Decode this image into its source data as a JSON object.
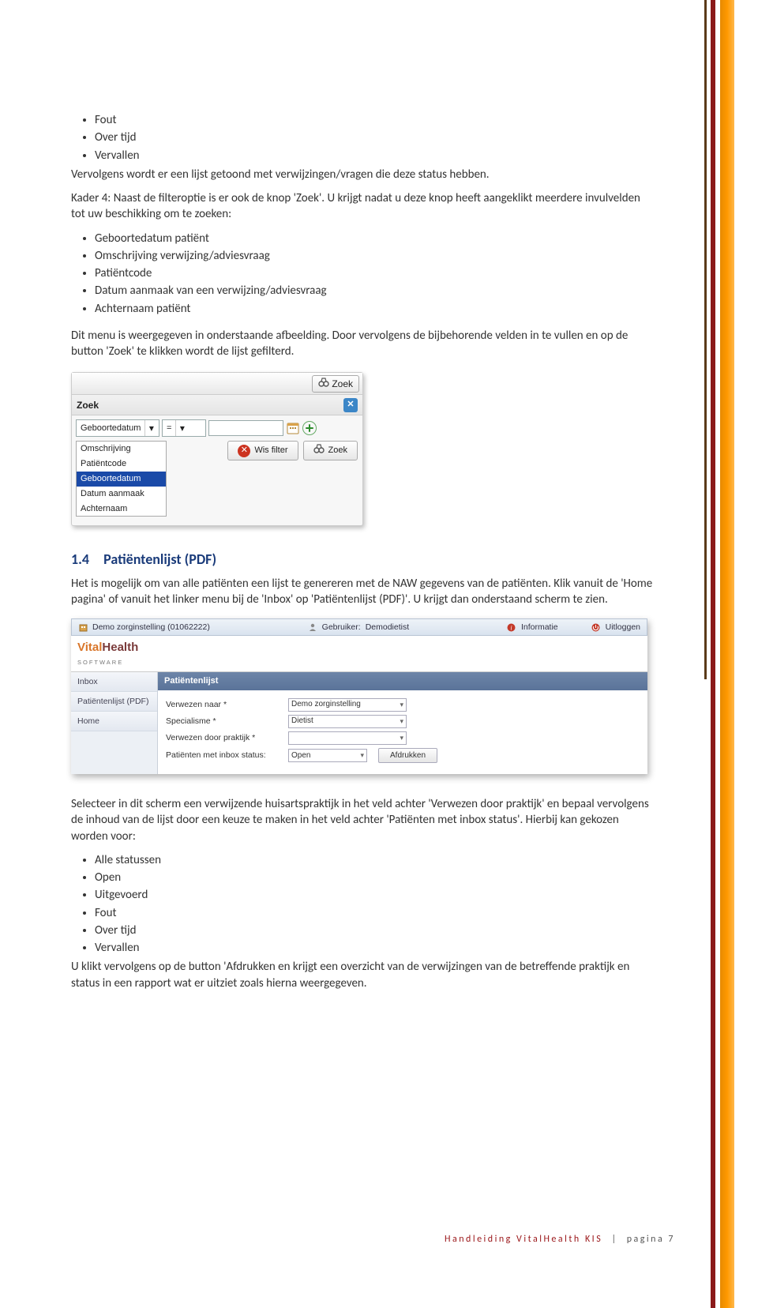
{
  "bullets_top": [
    "Fout",
    "Over tijd",
    "Vervallen"
  ],
  "para1": "Vervolgens wordt er een lijst getoond met verwijzingen/vragen die deze status hebben.",
  "para2": "Kader 4: Naast de filteroptie is er ook de knop 'Zoek'. U krijgt nadat u deze knop heeft aangeklikt meerdere invulvelden tot uw beschikking om te zoeken:",
  "bullets_mid": [
    "Geboortedatum patiënt",
    "Omschrijving verwijzing/adviesvraag",
    "Patiëntcode",
    "Datum aanmaak van een verwijzing/adviesvraag",
    "Achternaam patiënt"
  ],
  "para3": "Dit menu is weergegeven in onderstaande afbeelding. Door vervolgens de bijbehorende velden in te vullen en op de button 'Zoek' te klikken wordt de lijst gefilterd.",
  "zoek": {
    "top_btn": "Zoek",
    "header": "Zoek",
    "field_select": "Geboortedatum",
    "op_select": "=",
    "options": [
      "Omschrijving",
      "Patiëntcode",
      "Geboortedatum",
      "Datum aanmaak",
      "Achternaam"
    ],
    "hl_index": 2,
    "wis": "Wis filter",
    "zoekbtn": "Zoek"
  },
  "section_num": "1.4",
  "section_title": "Patiëntenlijst (PDF)",
  "para4": "Het is mogelijk om van alle patiënten een lijst te genereren met de NAW gegevens van de patiënten. Klik vanuit de 'Home pagina' of vanuit het linker menu bij de 'Inbox' op 'Patiëntenlijst (PDF)'. U krijgt dan onderstaand scherm te zien.",
  "app": {
    "org": "Demo zorginstelling (01062222)",
    "user_lbl": "Gebruiker:",
    "user": "Demodietist",
    "info": "Informatie",
    "logout": "Uitloggen",
    "brand1": "Vital",
    "brand2": "Health",
    "brandsub": "SOFTWARE",
    "side": [
      "Inbox",
      "Patiëntenlijst (PDF)",
      "Home"
    ],
    "panel": "Patiëntenlijst",
    "rows": [
      {
        "lbl": "Verwezen naar *",
        "val": "Demo zorginstelling"
      },
      {
        "lbl": "Specialisme *",
        "val": "Dietist"
      },
      {
        "lbl": "Verwezen door praktijk *",
        "val": ""
      },
      {
        "lbl": "Patiënten met inbox status:",
        "val": "Open"
      }
    ],
    "print": "Afdrukken"
  },
  "para5": "Selecteer in dit scherm een verwijzende huisartspraktijk in het veld achter 'Verwezen door praktijk' en bepaal vervolgens de inhoud van de lijst door een keuze te maken in het veld achter 'Patiënten met inbox status'. Hierbij kan gekozen worden voor:",
  "bullets_bot": [
    "Alle statussen",
    "Open",
    "Uitgevoerd",
    "Fout",
    "Over tijd",
    "Vervallen"
  ],
  "para6": "U klikt vervolgens op de button 'Afdrukken en krijgt een overzicht van de verwijzingen van de betreffende praktijk en status in een rapport wat er uitziet zoals hierna weergegeven.",
  "footer_left": "Handleiding VitalHealth KIS",
  "footer_sep": "|",
  "footer_right": "pagina 7"
}
